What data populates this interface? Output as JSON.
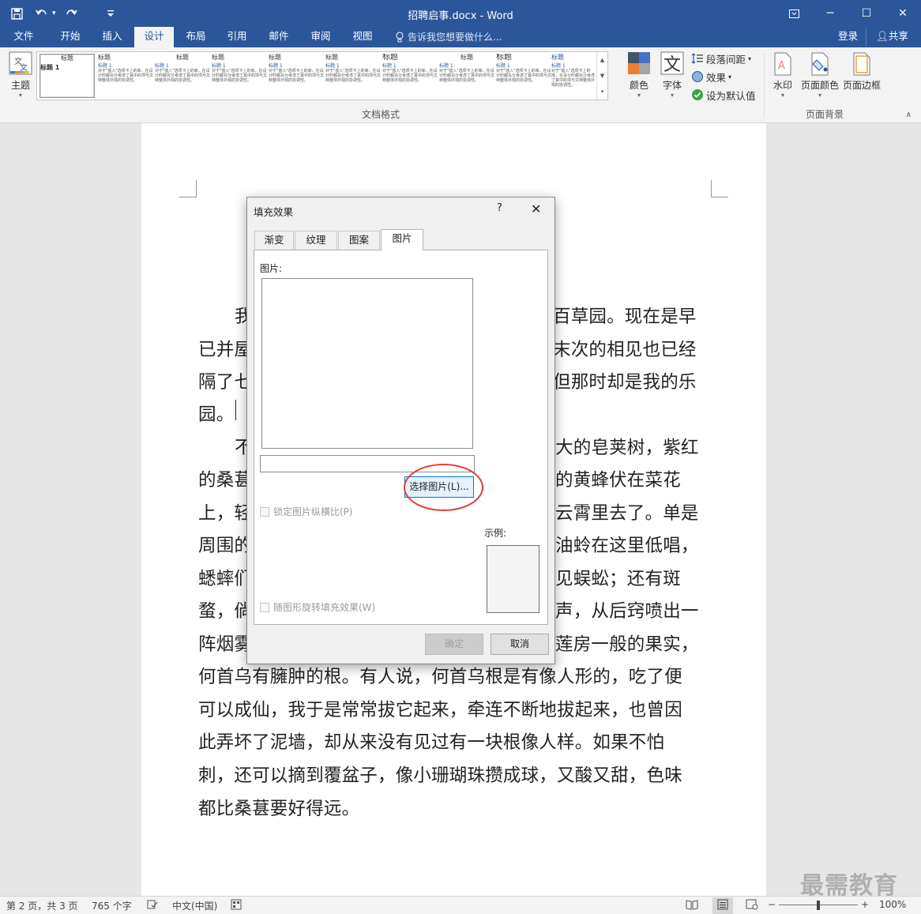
{
  "window": {
    "title": "招聘启事.docx - Word",
    "minimize": "─",
    "restore": "☐",
    "close": "✕"
  },
  "qat": {
    "save_icon": "save-icon",
    "undo_icon": "undo-icon",
    "redo_icon": "redo-icon",
    "customize_icon": "customize-icon"
  },
  "tabs": [
    {
      "label": "文件"
    },
    {
      "label": "开始"
    },
    {
      "label": "插入"
    },
    {
      "label": "设计"
    },
    {
      "label": "布局"
    },
    {
      "label": "引用"
    },
    {
      "label": "邮件"
    },
    {
      "label": "审阅"
    },
    {
      "label": "视图"
    }
  ],
  "active_tab": "设计",
  "tell_me": "告诉我您想要做什么...",
  "account": {
    "login": "登录",
    "share": "共享"
  },
  "ribbon": {
    "theme_label": "主题",
    "gallery_items": [
      {
        "title": "标题",
        "sub": "标题 1"
      },
      {
        "title": "标题",
        "sub": "标题 1"
      },
      {
        "title": "标题",
        "sub": "标题 1"
      },
      {
        "title": "标题",
        "sub": "标题 1"
      },
      {
        "title": "标题",
        "sub": "标题 1"
      },
      {
        "title": "标题",
        "sub": "标题 1"
      },
      {
        "title": "标题",
        "sub": "标题 1"
      },
      {
        "title": "标题",
        "sub": "标题 1"
      },
      {
        "title": "标题",
        "sub": "标题 1"
      },
      {
        "title": "标题",
        "sub": "标题 1"
      }
    ],
    "gallery_body": "对于\"插入\"选项卡上的库，在设计时都充分考虑了其中的项与文档整体外观的协调性。",
    "doc_format_group": "文档格式",
    "colors_label": "颜色",
    "fonts_label": "字体",
    "paragraph_spacing": "段落间距",
    "effects": "效果",
    "set_default": "设为默认值",
    "watermark_label": "水印",
    "page_color_label": "页面颜色",
    "page_border_label": "页面边框",
    "page_bg_group": "页面背景"
  },
  "document": {
    "lines": [
      "我",
      "百草园。现在是早",
      "已并屋",
      "末次的相见也已经",
      "隔了七",
      "但那时却是我的乐",
      "园。",
      "不",
      "大的皂荚树，紫红",
      "的桑葚",
      "的黄蜂伏在菜花",
      "上，轻",
      "云霄里去了。单是",
      "周围的",
      "油蛉在这里低唱，",
      "蟋蟀们",
      "见蜈蚣；还有斑",
      "蝥，倘",
      "声，从后窍喷出一",
      "阵烟雾",
      "莲房一般的果实，",
      "何首乌有臃肿的根。有人说，何首乌根是有像人形的，吃了便",
      "可以成仙，我于是常常拔它起来，牵连不断地拔起来，也曾因",
      "此弄坏了泥墙，却从来没有见过有一块根像人样。如果不怕",
      "刺，还可以摘到覆盆子，像小珊瑚珠攒成球，又酸又甜，色味",
      "都比桑葚要好得远。"
    ]
  },
  "dialog": {
    "title": "填充效果",
    "help": "?",
    "close": "✕",
    "tabs": [
      {
        "label": "渐变"
      },
      {
        "label": "纹理"
      },
      {
        "label": "图案"
      },
      {
        "label": "图片"
      }
    ],
    "active_tab": "图片",
    "picture_label": "图片:",
    "filename_value": "",
    "select_picture": "选择图片(L)...",
    "lock_aspect": "锁定图片纵横比(P)",
    "rotate_with_shape": "随图形旋转填充效果(W)",
    "sample_label": "示例:",
    "ok": "确定",
    "cancel": "取消"
  },
  "status": {
    "page": "第 2 页，共 3 页",
    "words": "765 个字",
    "language": "中文(中国)",
    "zoom": "100%",
    "zoom_level": 1.0
  },
  "brand_watermark": "最需教育"
}
